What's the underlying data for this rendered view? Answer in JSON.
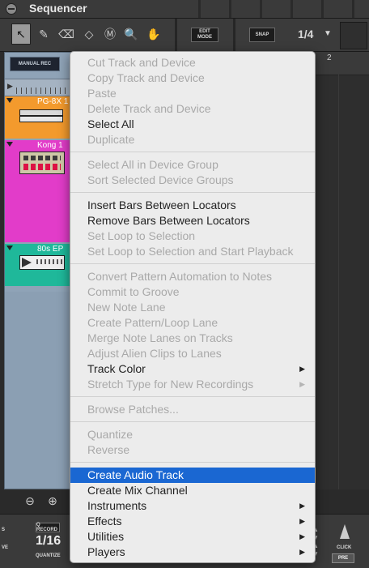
{
  "window": {
    "title": "Sequencer"
  },
  "toolbar": {
    "tools": [
      {
        "icon": "arrow-pointer-icon",
        "glyph": "↖",
        "active": true
      },
      {
        "icon": "pencil-icon",
        "glyph": "✎",
        "active": false
      },
      {
        "icon": "eraser-icon",
        "glyph": "⌫",
        "active": false
      },
      {
        "icon": "razor-icon",
        "glyph": "◇",
        "active": false
      },
      {
        "icon": "mute-icon",
        "glyph": "Ⓜ",
        "active": false
      },
      {
        "icon": "magnify-icon",
        "glyph": "🔍",
        "active": false
      },
      {
        "icon": "hand-icon",
        "glyph": "✋",
        "active": false
      }
    ],
    "edit_mode_label": "EDIT MODE",
    "snap_label": "SNAP",
    "snap_value": "1/4"
  },
  "tracks_pane": {
    "manual_rec_label": "MANUAL REC",
    "tracks": [
      {
        "name": "PG-8X 1",
        "color": "#f39a2d"
      },
      {
        "name": "Kong 1",
        "color": "#e23cc9"
      },
      {
        "name": "80s EP",
        "color": "#1fb89a"
      }
    ]
  },
  "timeline": {
    "bar_number": "2"
  },
  "transport": {
    "left_labels": [
      "S",
      "VE"
    ],
    "q_record_label": "Q RECORD",
    "quantize_value": "1/16",
    "quantize_label": "QUANTIZE",
    "click_label": "CLICK",
    "pre_label": "PRE"
  },
  "context_menu": {
    "items": [
      {
        "label": "Cut Track and Device",
        "enabled": false
      },
      {
        "label": "Copy Track and Device",
        "enabled": false
      },
      {
        "label": "Paste",
        "enabled": false
      },
      {
        "label": "Delete Track and Device",
        "enabled": false
      },
      {
        "label": "Select All",
        "enabled": true
      },
      {
        "label": "Duplicate",
        "enabled": false
      },
      {
        "separator": true
      },
      {
        "label": "Select All in Device Group",
        "enabled": false
      },
      {
        "label": "Sort Selected Device Groups",
        "enabled": false
      },
      {
        "separator": true
      },
      {
        "label": "Insert Bars Between Locators",
        "enabled": true
      },
      {
        "label": "Remove Bars Between Locators",
        "enabled": true
      },
      {
        "label": "Set Loop to Selection",
        "enabled": false
      },
      {
        "label": "Set Loop to Selection and Start Playback",
        "enabled": false
      },
      {
        "separator": true
      },
      {
        "label": "Convert Pattern Automation to Notes",
        "enabled": false
      },
      {
        "label": "Commit to Groove",
        "enabled": false
      },
      {
        "label": "New Note Lane",
        "enabled": false
      },
      {
        "label": "Create Pattern/Loop Lane",
        "enabled": false
      },
      {
        "label": "Merge Note Lanes on Tracks",
        "enabled": false
      },
      {
        "label": "Adjust Alien Clips to Lanes",
        "enabled": false
      },
      {
        "label": "Track Color",
        "enabled": true,
        "submenu": true
      },
      {
        "label": "Stretch Type for New Recordings",
        "enabled": false,
        "submenu": true
      },
      {
        "separator": true
      },
      {
        "label": "Browse Patches...",
        "enabled": false
      },
      {
        "separator": true
      },
      {
        "label": "Quantize",
        "enabled": false
      },
      {
        "label": "Reverse",
        "enabled": false
      },
      {
        "separator": true
      },
      {
        "label": "Create Audio Track",
        "enabled": true,
        "highlighted": true
      },
      {
        "label": "Create Mix Channel",
        "enabled": true
      },
      {
        "label": "Instruments",
        "enabled": true,
        "submenu": true
      },
      {
        "label": "Effects",
        "enabled": true,
        "submenu": true
      },
      {
        "label": "Utilities",
        "enabled": true,
        "submenu": true
      },
      {
        "label": "Players",
        "enabled": true,
        "submenu": true
      }
    ]
  }
}
